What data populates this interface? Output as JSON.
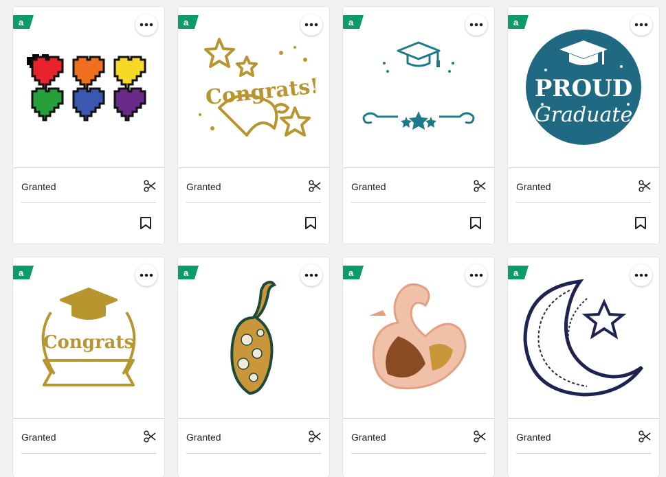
{
  "colors": {
    "badge_green": "#0f9b68",
    "text": "#222222",
    "card_bg": "#ffffff",
    "page_bg": "#f2f2f2"
  },
  "badge_icon": "access-a-icon",
  "cards": [
    {
      "label": "Granted",
      "image": "pixel-hearts",
      "icons": [
        "more-icon",
        "scissors-icon",
        "bookmark-icon"
      ]
    },
    {
      "label": "Granted",
      "image": "congrats-stars-gold",
      "icons": [
        "more-icon",
        "scissors-icon",
        "bookmark-icon"
      ]
    },
    {
      "label": "Granted",
      "image": "graduation-cap-diplomas-teal",
      "icons": [
        "more-icon",
        "scissors-icon",
        "bookmark-icon"
      ]
    },
    {
      "label": "Granted",
      "image": "proud-graduate-circle",
      "icons": [
        "more-icon",
        "scissors-icon",
        "bookmark-icon"
      ]
    },
    {
      "label": "Granted",
      "image": "congrats-wreath-cap-gold",
      "icons": [
        "more-icon",
        "scissors-icon",
        "bookmark-icon"
      ]
    },
    {
      "label": "Granted",
      "image": "peacock-mandala",
      "icons": [
        "more-icon",
        "scissors-icon",
        "bookmark-icon"
      ]
    },
    {
      "label": "Granted",
      "image": "swan-mandala",
      "icons": [
        "more-icon",
        "scissors-icon",
        "bookmark-icon"
      ]
    },
    {
      "label": "Granted",
      "image": "crescent-moon-star",
      "icons": [
        "more-icon",
        "scissors-icon",
        "bookmark-icon"
      ]
    }
  ],
  "proud_graduate_text": {
    "line1": "PROUD",
    "line2": "Graduate"
  },
  "congrats_text": "Congrats!",
  "congrats_text2": "Congrats"
}
